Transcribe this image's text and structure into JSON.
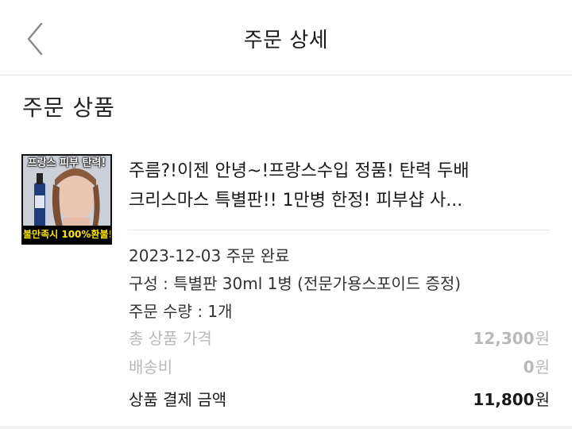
{
  "header": {
    "title": "주문 상세"
  },
  "section": {
    "title": "주문 상품"
  },
  "product": {
    "name_line1": "주름?!이젠 안녕~!프랑스수입 정품! 탄력 두배",
    "name_line2": "크리스마스 특별판!! 1만병 한정! 피부샵 사...",
    "thumb_top_text": "프랑스 피부 탄력!",
    "thumb_bottom_text": "불만족시 100%환불!",
    "order_status": "2023-12-03 주문 완료",
    "option": "구성 : 특별판 30ml 1병  (전문가용스포이드 증정)",
    "quantity": "주문 수량 : 1개"
  },
  "prices": {
    "total_label": "총 상품 가격",
    "total_value": "12,300",
    "shipping_label": "배송비",
    "shipping_value": "0",
    "payment_label": "상품 결제 금액",
    "payment_value": "11,800",
    "currency_unit": "원"
  },
  "colors": {
    "accent_text": "#1a1a1a",
    "muted_text": "#b9b9b9",
    "divider": "#e6e6e6",
    "thumb_badge_bg": "#000000",
    "thumb_badge_text": "#ffe600"
  },
  "icons": {
    "back": "chevron-left-icon"
  }
}
